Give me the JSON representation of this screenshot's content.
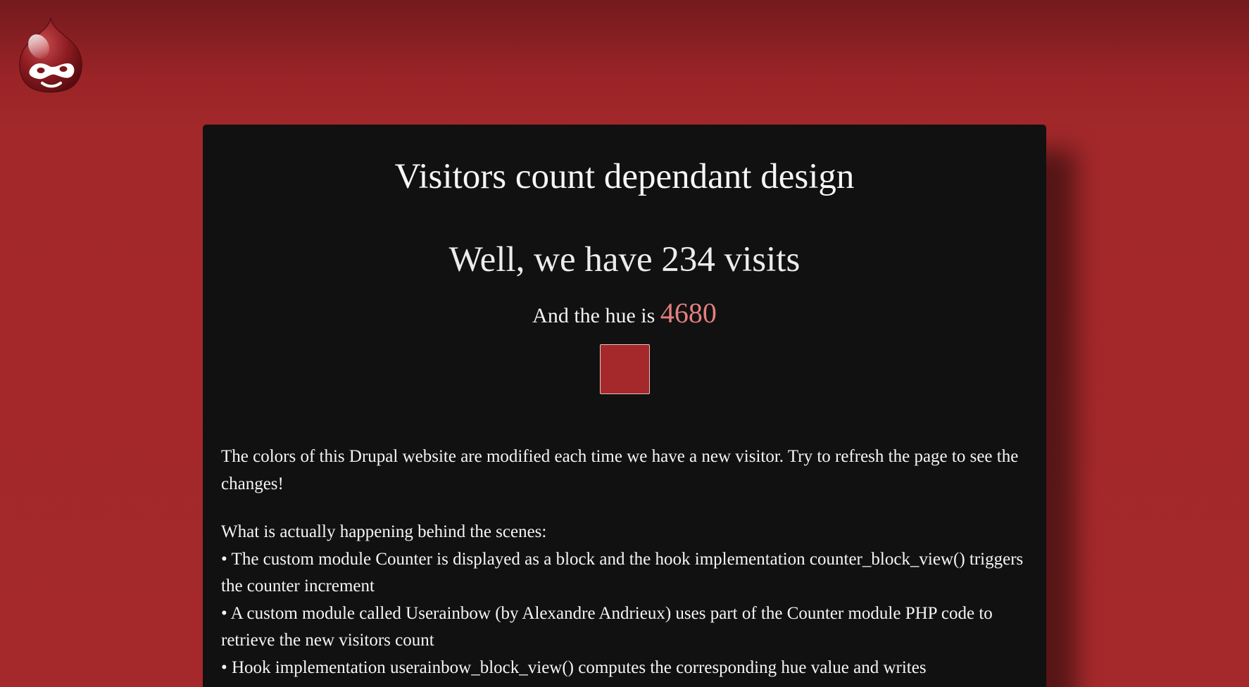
{
  "logo": {
    "icon": "drupal-drop-logo",
    "alt": "Drupal"
  },
  "colors": {
    "background": "#a5292b",
    "panel": "#111111",
    "hue_value_text": "#e57f7f",
    "swatch": "#a5292b"
  },
  "page": {
    "title": "Visitors count dependant design",
    "visits_heading": "Well, we have 234 visits",
    "hue_prefix": "And the hue is ",
    "hue_value": "4680"
  },
  "content": {
    "intro": "The colors of this Drupal website are modified each time we have a new visitor. Try to refresh the page to see the changes!",
    "behind_heading": "What is actually happening behind the scenes:",
    "items": [
      "• The custom module Counter is displayed as a block and the hook implementation counter_block_view() triggers the counter increment",
      "• A custom module called Userainbow (by Alexandre Andrieux) uses part of the Counter module PHP code to retrieve the new visitors count",
      "• Hook implementation userainbow_block_view() computes the corresponding hue value and writes"
    ]
  }
}
